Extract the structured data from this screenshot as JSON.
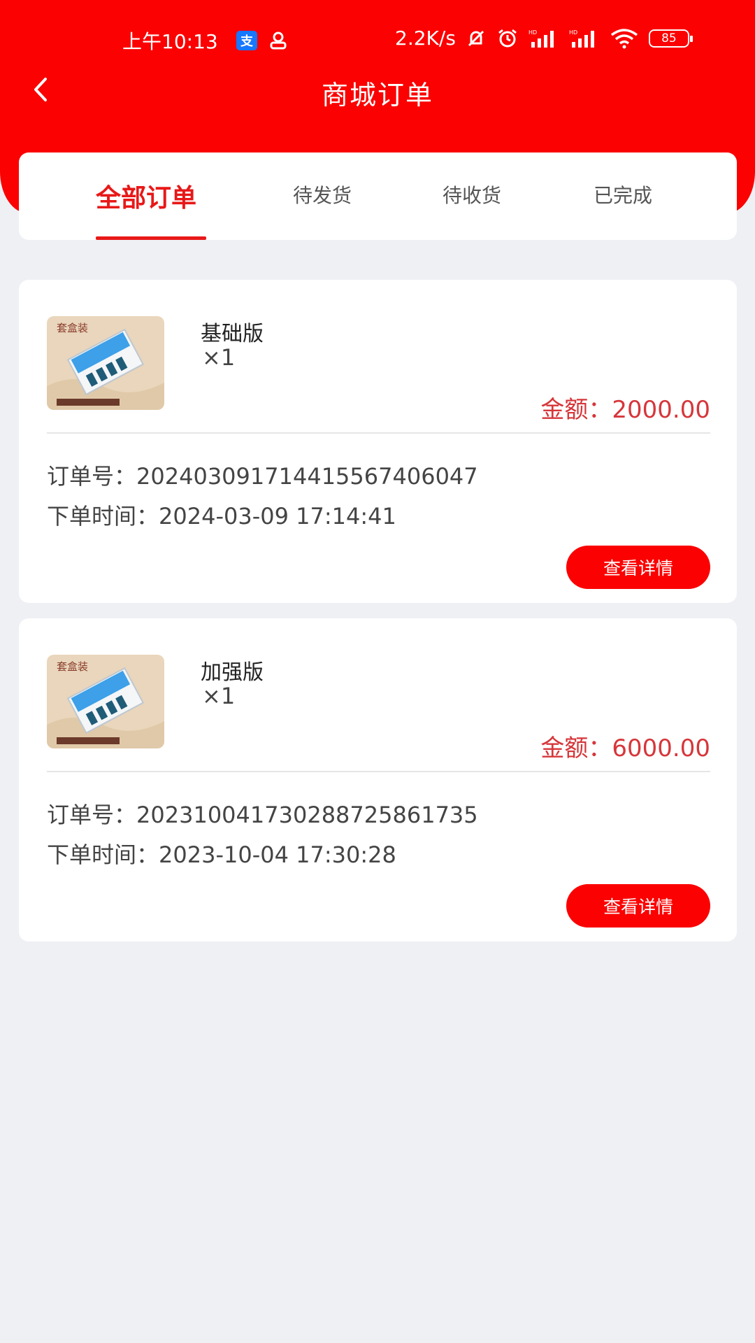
{
  "status_bar": {
    "time": "上午10:13",
    "app_icon_1": "支",
    "speed": "2.2K/s",
    "battery": "85"
  },
  "nav": {
    "title": "商城订单"
  },
  "tabs": [
    {
      "label": "全部订单",
      "active": true
    },
    {
      "label": "待发货"
    },
    {
      "label": "待收货"
    },
    {
      "label": "已完成"
    }
  ],
  "orders": [
    {
      "product_image_text": "套盒装",
      "product_name": "基础版",
      "quantity": "×1",
      "amount_label": "金额：",
      "amount": "2000.00",
      "order_no_label": "订单号：",
      "order_no": "20240309171441556740604 7",
      "order_time_label": "下单时间：",
      "order_time": "2024-03-09 17:14:41",
      "detail_button": "查看详情"
    },
    {
      "product_image_text": "套盒装",
      "product_name": "加强版",
      "quantity": "×1",
      "amount_label": "金额：",
      "amount": "6000.00",
      "order_no_label": "订单号：",
      "order_no": "2023100417302887258617 35",
      "order_time_label": "下单时间：",
      "order_time": "2023-10-04 17:30:28",
      "detail_button": "查看详情"
    }
  ],
  "colors": {
    "brand_red": "#fb0101",
    "active_tab": "#e81818",
    "amount": "#d6363a",
    "background": "#eff0f4"
  },
  "icons": {
    "back": "chevron-left-icon",
    "mute": "bell-off-icon",
    "alarm": "alarm-icon",
    "signal": "signal-icon",
    "wifi": "wifi-icon",
    "battery": "battery-icon"
  }
}
